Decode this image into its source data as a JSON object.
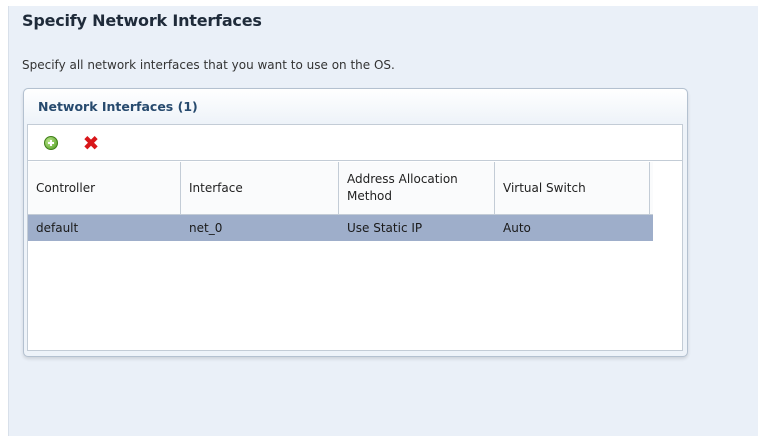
{
  "page": {
    "title": "Specify Network Interfaces",
    "description": "Specify all network interfaces that you want to use on the OS."
  },
  "panel": {
    "title": "Network Interfaces (1)",
    "toolbar": {
      "add_icon": "add-icon",
      "delete_icon": "delete-icon"
    }
  },
  "table": {
    "columns": [
      "Controller",
      "Interface",
      "Address Allocation Method",
      "Virtual Switch"
    ],
    "rows": [
      {
        "controller": "default",
        "interface": "net_0",
        "method": "Use Static IP",
        "switch": "Auto",
        "selected": true
      }
    ]
  },
  "colors": {
    "selected_row": "#9eaeca",
    "delete_icon": "#d8161a",
    "add_icon": "#4e9a1f"
  }
}
